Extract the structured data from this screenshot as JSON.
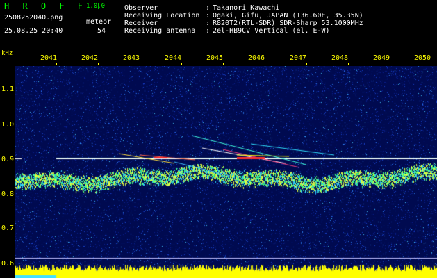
{
  "header": {
    "app_title": "H R O F F T",
    "app_version": "1.0.0",
    "file_name": "2508252040.png",
    "date_time": "25.08.25 20:40",
    "meteor_label": "meteor",
    "meteor_count": "54"
  },
  "info": [
    {
      "key": "Observer",
      "value": "Takanori Kawachi"
    },
    {
      "key": "Receiving Location",
      "value": "Ogaki, Gifu, JAPAN (136.60E, 35.35N)"
    },
    {
      "key": "Receiver",
      "value": "R820T2(RTL-SDR) SDR-Sharp 53.1000MHz"
    },
    {
      "key": "Receiving antenna",
      "value": "2el-HB9CV Vertical (el. E-W)"
    }
  ],
  "axes": {
    "unit": "kHz",
    "time_ticks": [
      "2041",
      "2042",
      "2043",
      "2044",
      "2045",
      "2046",
      "2047",
      "2048",
      "2049",
      "2050"
    ],
    "freq_ticks": [
      "1.1",
      "1.0",
      "0.9",
      "0.8",
      "0.7",
      "0.6"
    ]
  },
  "colors": {
    "header_green": "#00ff00",
    "axis_yellow": "#ffff00",
    "carrier": "#a0ffe0",
    "noise_floor": "#000a50",
    "echo_hot": "#ff3030"
  }
}
